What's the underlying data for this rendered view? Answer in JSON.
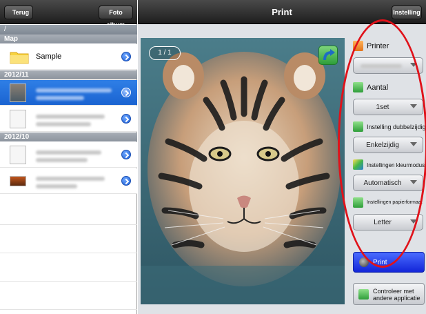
{
  "left_nav": {
    "back_label": "Terug",
    "album_label": "Foto album"
  },
  "path": "/",
  "sections": [
    "Map",
    "2012/11",
    "2012/10"
  ],
  "folder": {
    "label": "Sample"
  },
  "main_nav": {
    "title": "Print",
    "setting_label": "Instelling"
  },
  "preview": {
    "page_counter": "1 / 1"
  },
  "settings": {
    "printer": {
      "label": "Printer"
    },
    "copies": {
      "label": "Aantal",
      "value": "1set"
    },
    "duplex": {
      "label": "Instelling dubbelzijdig",
      "value": "Enkelzijdig"
    },
    "color": {
      "label": "Instellingen kleurmodus",
      "value": "Automatisch"
    },
    "paper": {
      "label": "Instellingen papierformaat",
      "value": "Letter"
    }
  },
  "actions": {
    "print_label": "Print",
    "check_line1": "Controleer met",
    "check_line2": "andere applicatie"
  },
  "colors": {
    "accent_blue": "#1a63d1",
    "print_button": "#1225d8",
    "annotation": "#e0121a"
  }
}
